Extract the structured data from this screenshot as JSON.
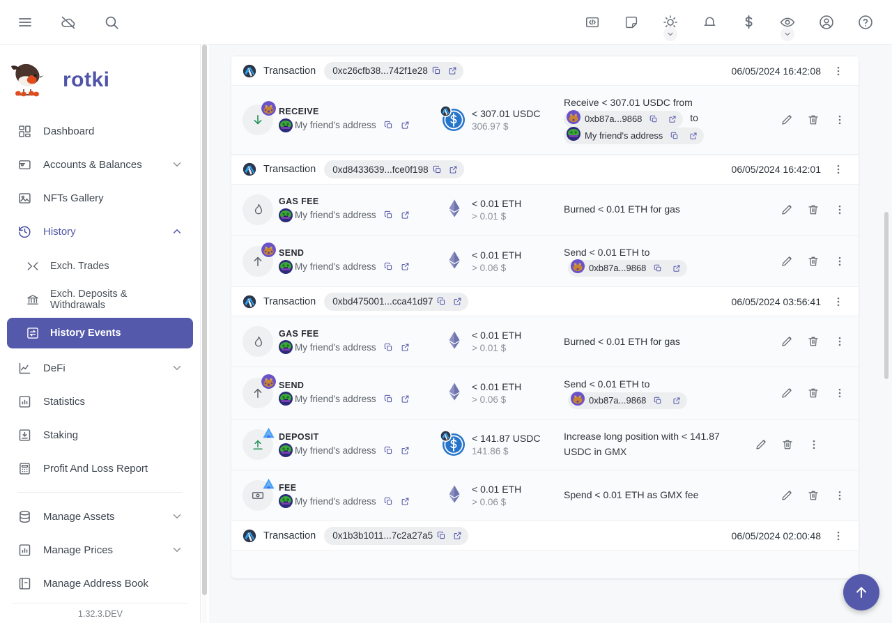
{
  "app": {
    "brand": "rotki",
    "version": "1.32.3.DEV"
  },
  "topbar": {
    "left_icons": [
      {
        "name": "menu-icon",
        "label": "Menu"
      },
      {
        "name": "cloud-off-icon",
        "label": "Sync disabled"
      },
      {
        "name": "search-icon",
        "label": "Search"
      }
    ],
    "right_icons": [
      {
        "name": "code-icon",
        "label": "Developer"
      },
      {
        "name": "notes-icon",
        "label": "Notes"
      },
      {
        "name": "theme-sun-icon",
        "label": "Theme"
      },
      {
        "name": "bell-icon",
        "label": "Notifications"
      },
      {
        "name": "dollar-icon",
        "label": "Currency"
      },
      {
        "name": "eye-icon",
        "label": "Privacy mode"
      },
      {
        "name": "account-circle-icon",
        "label": "Account"
      },
      {
        "name": "help-circle-icon",
        "label": "Help"
      }
    ]
  },
  "sidebar": {
    "items": [
      {
        "label": "Dashboard",
        "icon": "dashboard-icon",
        "type": "item"
      },
      {
        "label": "Accounts & Balances",
        "icon": "wallet-icon",
        "type": "group",
        "expanded": false
      },
      {
        "label": "NFTs Gallery",
        "icon": "image-icon",
        "type": "item"
      },
      {
        "label": "History",
        "icon": "history-clock-icon",
        "type": "group",
        "expanded": true,
        "active": true
      },
      {
        "label": "Exch. Trades",
        "icon": "shuffle-icon",
        "type": "sub"
      },
      {
        "label": "Exch. Deposits & Withdrawals",
        "icon": "bank-icon",
        "type": "sub"
      },
      {
        "label": "History Events",
        "icon": "history-events-icon",
        "type": "sub",
        "selected": true
      },
      {
        "label": "DeFi",
        "icon": "line-chart-icon",
        "type": "group",
        "expanded": false
      },
      {
        "label": "Statistics",
        "icon": "bar-chart-doc-icon",
        "type": "item"
      },
      {
        "label": "Staking",
        "icon": "inbox-down-icon",
        "type": "item"
      },
      {
        "label": "Profit And Loss Report",
        "icon": "calculator-icon",
        "type": "item"
      },
      {
        "label": "Manage Assets",
        "icon": "database-icon",
        "type": "group",
        "expanded": false
      },
      {
        "label": "Manage Prices",
        "icon": "price-chart-icon",
        "type": "group",
        "expanded": false
      },
      {
        "label": "Manage Address Book",
        "icon": "address-book-icon",
        "type": "item"
      }
    ]
  },
  "main": {
    "scroll_to_top_label": "Scroll to top",
    "groups": [
      {
        "header": {
          "chain_icon": "arbitrum-icon",
          "label": "Transaction",
          "hash": "0xc26cfb38...742f1e28",
          "copy_label": "Copy",
          "external_label": "Open in explorer",
          "timestamp": "06/05/2024 16:42:08"
        },
        "events": [
          {
            "kind": "RECEIVE",
            "badge_icon": "arrow-down-icon",
            "badge_color": "#1f9254",
            "corner_avatar": "identicon-purple",
            "address_avatar": "identicon-green",
            "address_name": "My friend's address",
            "asset_icon": "usdc-icon",
            "asset_chain_badge": "arbitrum-icon",
            "amount": "< 307.01 USDC",
            "fiat": "306.97 $",
            "notes_prefix": "Receive < 307.01 USDC from",
            "notes_chip_1": "0xb87a...9868",
            "notes_middle": "to",
            "notes_chip_2": "My friend's address",
            "notes_suffix": ""
          }
        ]
      },
      {
        "header": {
          "chain_icon": "arbitrum-icon",
          "label": "Transaction",
          "hash": "0xd8433639...fce0f198",
          "copy_label": "Copy",
          "external_label": "Open in explorer",
          "timestamp": "06/05/2024 16:42:01"
        },
        "events": [
          {
            "kind": "GAS FEE",
            "badge_icon": "flame-icon",
            "badge_color": "#5d636b",
            "corner_avatar": "",
            "address_avatar": "identicon-green",
            "address_name": "My friend's address",
            "asset_icon": "eth-icon",
            "asset_chain_badge": "",
            "amount": "< 0.01 ETH",
            "fiat": "> 0.01 $",
            "notes_prefix": "Burned < 0.01 ETH for gas",
            "notes_chip_1": "",
            "notes_middle": "",
            "notes_chip_2": "",
            "notes_suffix": ""
          },
          {
            "kind": "SEND",
            "badge_icon": "arrow-up-icon",
            "badge_color": "#5d636b",
            "corner_avatar": "identicon-purple",
            "address_avatar": "identicon-green",
            "address_name": "My friend's address",
            "asset_icon": "eth-icon",
            "asset_chain_badge": "",
            "amount": "< 0.01 ETH",
            "fiat": "> 0.06 $",
            "notes_prefix": "Send < 0.01 ETH to",
            "notes_chip_1": "0xb87a...9868",
            "notes_middle": "",
            "notes_chip_2": "",
            "notes_suffix": ""
          }
        ]
      },
      {
        "header": {
          "chain_icon": "arbitrum-icon",
          "label": "Transaction",
          "hash": "0xbd475001...cca41d97",
          "copy_label": "Copy",
          "external_label": "Open in explorer",
          "timestamp": "06/05/2024 03:56:41"
        },
        "events": [
          {
            "kind": "GAS FEE",
            "badge_icon": "flame-icon",
            "badge_color": "#5d636b",
            "corner_avatar": "",
            "address_avatar": "identicon-green",
            "address_name": "My friend's address",
            "asset_icon": "eth-icon",
            "asset_chain_badge": "",
            "amount": "< 0.01 ETH",
            "fiat": "> 0.01 $",
            "notes_prefix": "Burned < 0.01 ETH for gas",
            "notes_chip_1": "",
            "notes_middle": "",
            "notes_chip_2": "",
            "notes_suffix": ""
          },
          {
            "kind": "SEND",
            "badge_icon": "arrow-up-icon",
            "badge_color": "#5d636b",
            "corner_avatar": "identicon-purple",
            "address_avatar": "identicon-green",
            "address_name": "My friend's address",
            "asset_icon": "eth-icon",
            "asset_chain_badge": "",
            "amount": "< 0.01 ETH",
            "fiat": "> 0.06 $",
            "notes_prefix": "Send < 0.01 ETH to",
            "notes_chip_1": "0xb87a...9868",
            "notes_middle": "",
            "notes_chip_2": "",
            "notes_suffix": ""
          },
          {
            "kind": "DEPOSIT",
            "badge_icon": "upload-line-icon",
            "badge_color": "#1f9254",
            "corner_avatar": "gmx-icon",
            "address_avatar": "identicon-green",
            "address_name": "My friend's address",
            "asset_icon": "usdc-icon",
            "asset_chain_badge": "arbitrum-icon",
            "amount": "< 141.87 USDC",
            "fiat": "141.86 $",
            "notes_prefix": "Increase long position with < 141.87 USDC in GMX",
            "notes_chip_1": "",
            "notes_middle": "",
            "notes_chip_2": "",
            "notes_suffix": ""
          },
          {
            "kind": "FEE",
            "badge_icon": "banknote-icon",
            "badge_color": "#5d636b",
            "corner_avatar": "gmx-icon",
            "address_avatar": "identicon-green",
            "address_name": "My friend's address",
            "asset_icon": "eth-icon",
            "asset_chain_badge": "",
            "amount": "< 0.01 ETH",
            "fiat": "> 0.06 $",
            "notes_prefix": "Spend < 0.01 ETH as GMX fee",
            "notes_chip_1": "",
            "notes_middle": "",
            "notes_chip_2": "",
            "notes_suffix": ""
          }
        ]
      },
      {
        "header": {
          "chain_icon": "arbitrum-icon",
          "label": "Transaction",
          "hash": "0x1b3b1011...7c2a27a5",
          "copy_label": "Copy",
          "external_label": "Open in explorer",
          "timestamp": "06/05/2024 02:00:48"
        },
        "events": []
      }
    ],
    "row_actions": {
      "edit_label": "Edit",
      "delete_label": "Delete",
      "more_label": "More"
    }
  },
  "colors": {
    "accent": "#5459ab",
    "positive": "#1f9254",
    "muted": "#8b9098",
    "row_bg": "#fafbfc",
    "page_bg": "#f7f8fa"
  }
}
